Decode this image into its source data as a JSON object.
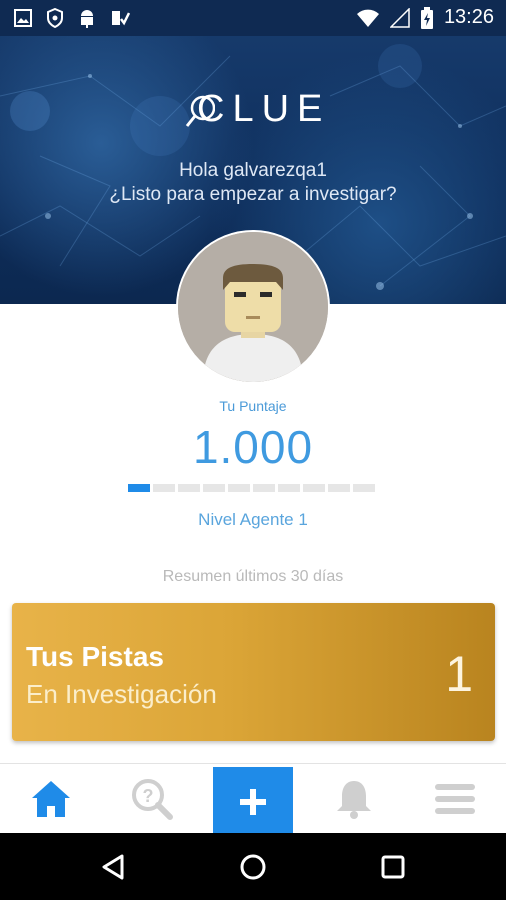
{
  "status_bar": {
    "time": "13:26",
    "left_icons": [
      "image-icon",
      "shield-icon",
      "android-icon",
      "app-check-icon"
    ],
    "right_icons": [
      "wifi-icon",
      "signal-icon",
      "battery-icon"
    ]
  },
  "hero": {
    "logo_text": "CLUE",
    "greeting_line1": "Hola galvarezqa1",
    "greeting_line2": "¿Listo para empezar a investigar?"
  },
  "score": {
    "label": "Tu Puntaje",
    "value": "1.000",
    "progress_segments_total": 10,
    "progress_segments_filled": 1,
    "level": "Nivel Agente 1"
  },
  "summary_label": "Resumen últimos 30 días",
  "card": {
    "title": "Tus Pistas",
    "subtitle": "En Investigación",
    "count": "1"
  },
  "tabs": [
    {
      "icon": "home-icon",
      "active": true
    },
    {
      "icon": "search-question-icon",
      "active": false
    },
    {
      "icon": "add-icon",
      "active": false
    },
    {
      "icon": "bell-icon",
      "active": false
    },
    {
      "icon": "menu-icon",
      "active": false
    }
  ],
  "nav": [
    "back-icon",
    "home-circle-icon",
    "recents-icon"
  ],
  "colors": {
    "accent": "#1f8be8",
    "hero_dark": "#0e2d5a",
    "card_gold": "#dba537",
    "inactive_icon": "#cfcfcf"
  }
}
